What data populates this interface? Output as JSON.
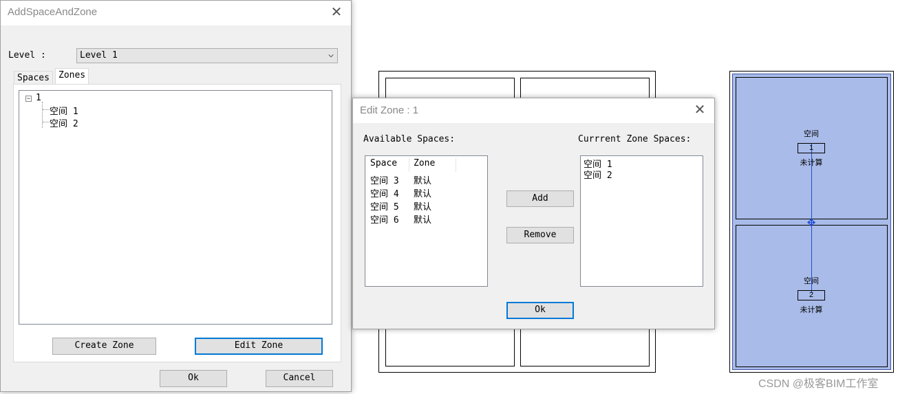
{
  "main_dialog": {
    "title": "AddSpaceAndZone",
    "level_label": "Level :",
    "level_value": "Level 1",
    "tabs": [
      {
        "label": "Spaces"
      },
      {
        "label": "Zones",
        "active": true
      }
    ],
    "tree": {
      "root_label": "1",
      "children": [
        "空间 1",
        "空间 2"
      ]
    },
    "create_zone_label": "Create Zone",
    "edit_zone_label": "Edit Zone",
    "ok_label": "Ok",
    "cancel_label": "Cancel"
  },
  "edit_dialog": {
    "title": "Edit Zone : 1",
    "available_label": "Available Spaces:",
    "current_label": "Currrent Zone Spaces:",
    "columns": [
      "Space",
      "Zone"
    ],
    "available_rows": [
      {
        "space": "空间 3",
        "zone": "默认"
      },
      {
        "space": "空间 4",
        "zone": "默认"
      },
      {
        "space": "空间 5",
        "zone": "默认"
      },
      {
        "space": "空间 6",
        "zone": "默认"
      }
    ],
    "current_items": [
      "空间 1",
      "空间 2"
    ],
    "add_label": "Add",
    "remove_label": "Remove",
    "ok_label": "Ok"
  },
  "canvas": {
    "zone_fill_color": "#a9bbe8",
    "tags": [
      {
        "name": "空间",
        "number": "1",
        "area": "未计算"
      },
      {
        "name": "空间",
        "number": "2",
        "area": "未计算"
      }
    ]
  },
  "watermark": "CSDN @极客BIM工作室"
}
